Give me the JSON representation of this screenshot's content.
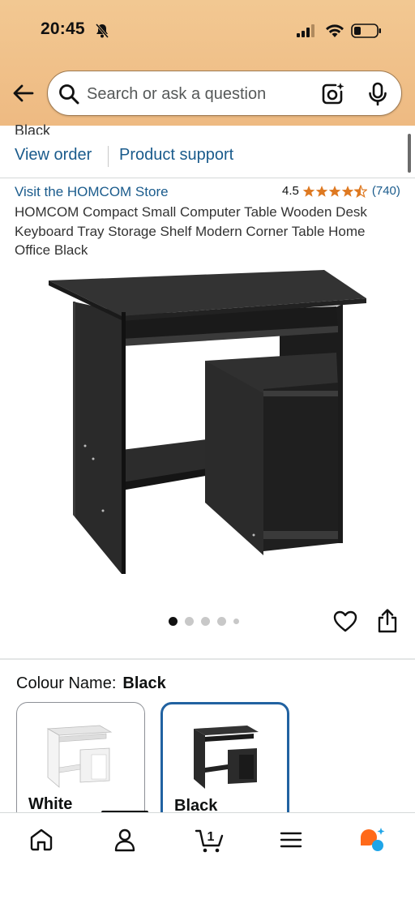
{
  "status_bar": {
    "time": "20:45",
    "icons": [
      "bell-slash-icon",
      "cellular-signal-icon",
      "wifi-icon",
      "battery-icon"
    ]
  },
  "header": {
    "search_placeholder": "Search or ask a question",
    "icons": [
      "back-arrow-icon",
      "search-icon",
      "camera-lens-icon",
      "microphone-icon"
    ]
  },
  "order_strip": {
    "cut_off_text": "Black",
    "view_order_label": "View order",
    "product_support_label": "Product support"
  },
  "product": {
    "store_link": "Visit the HOMCOM Store",
    "rating_value": "4.5",
    "rating_count": "(740)",
    "stars": 4.5,
    "title": "HOMCOM Compact Small Computer Table Wooden Desk Keyboard Tray Storage Shelf Modern Corner Table Home Office Black",
    "image_count": 5,
    "active_image_index": 0
  },
  "variations": {
    "label": "Colour Name:",
    "selected": "Black",
    "options": [
      {
        "name": "White",
        "selected": false
      },
      {
        "name": "Black",
        "selected": true
      }
    ]
  },
  "bottom_nav": {
    "items": [
      "home-icon",
      "account-icon",
      "cart-icon",
      "menu-icon",
      "rufus-assistant-icon"
    ],
    "cart_count": "1",
    "active_index": 1
  },
  "colors": {
    "header_bg": "#f2c892",
    "link": "#1a5b8c",
    "star": "#de7921",
    "selected_border": "#2162a1",
    "assistant_orange": "#ff6a1a",
    "assistant_blue": "#1fa5e8"
  }
}
